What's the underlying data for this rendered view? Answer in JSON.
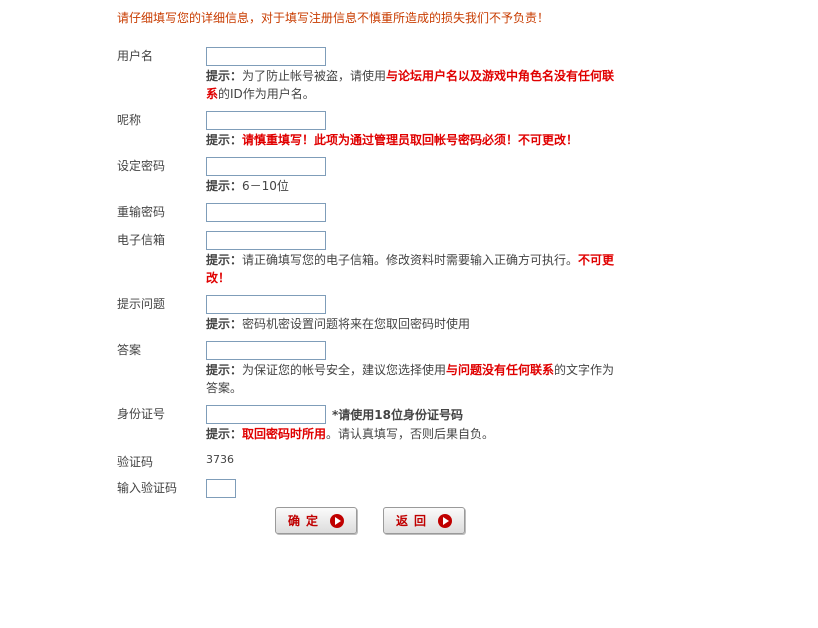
{
  "notice": "请仔细填写您的详细信息，对于填写注册信息不慎重所造成的损失我们不予负责！",
  "hint_prefix": "提示：",
  "fields": {
    "username": {
      "label": "用户名",
      "value": "",
      "hint_a": "为了防止帐号被盗，请使用",
      "hint_red": "与论坛用户名以及游戏中角色名没有任何联系",
      "hint_b": "的ID作为用户名。"
    },
    "nickname": {
      "label": "呢称",
      "value": "",
      "hint_red": "请慎重填写！此项为通过管理员取回帐号密码必须！不可更改！"
    },
    "password": {
      "label": "设定密码",
      "value": "",
      "hint_a": "6－10位"
    },
    "confirm_password": {
      "label": "重输密码",
      "value": ""
    },
    "email": {
      "label": "电子信箱",
      "value": "",
      "hint_a": "请正确填写您的电子信箱。修改资料时需要输入正确方可执行。",
      "hint_red": "不可更改！"
    },
    "question": {
      "label": "提示问题",
      "value": "",
      "hint_a": "密码机密设置问题将来在您取回密码时使用"
    },
    "answer": {
      "label": "答案",
      "value": "",
      "hint_a": "为保证您的帐号安全，建议您选择使用",
      "hint_red": "与问题没有任何联系",
      "hint_b": "的文字作为答案。"
    },
    "id_card": {
      "label": "身份证号",
      "value": "",
      "inline_note": "*请使用18位身份证号码",
      "hint_red": "取回密码时所用",
      "hint_b": "。请认真填写，否则后果自负。"
    },
    "captcha": {
      "label": "验证码",
      "code": "3736"
    },
    "captcha_input": {
      "label": "输入验证码",
      "value": ""
    }
  },
  "buttons": {
    "confirm": "确定",
    "back": "返回"
  }
}
